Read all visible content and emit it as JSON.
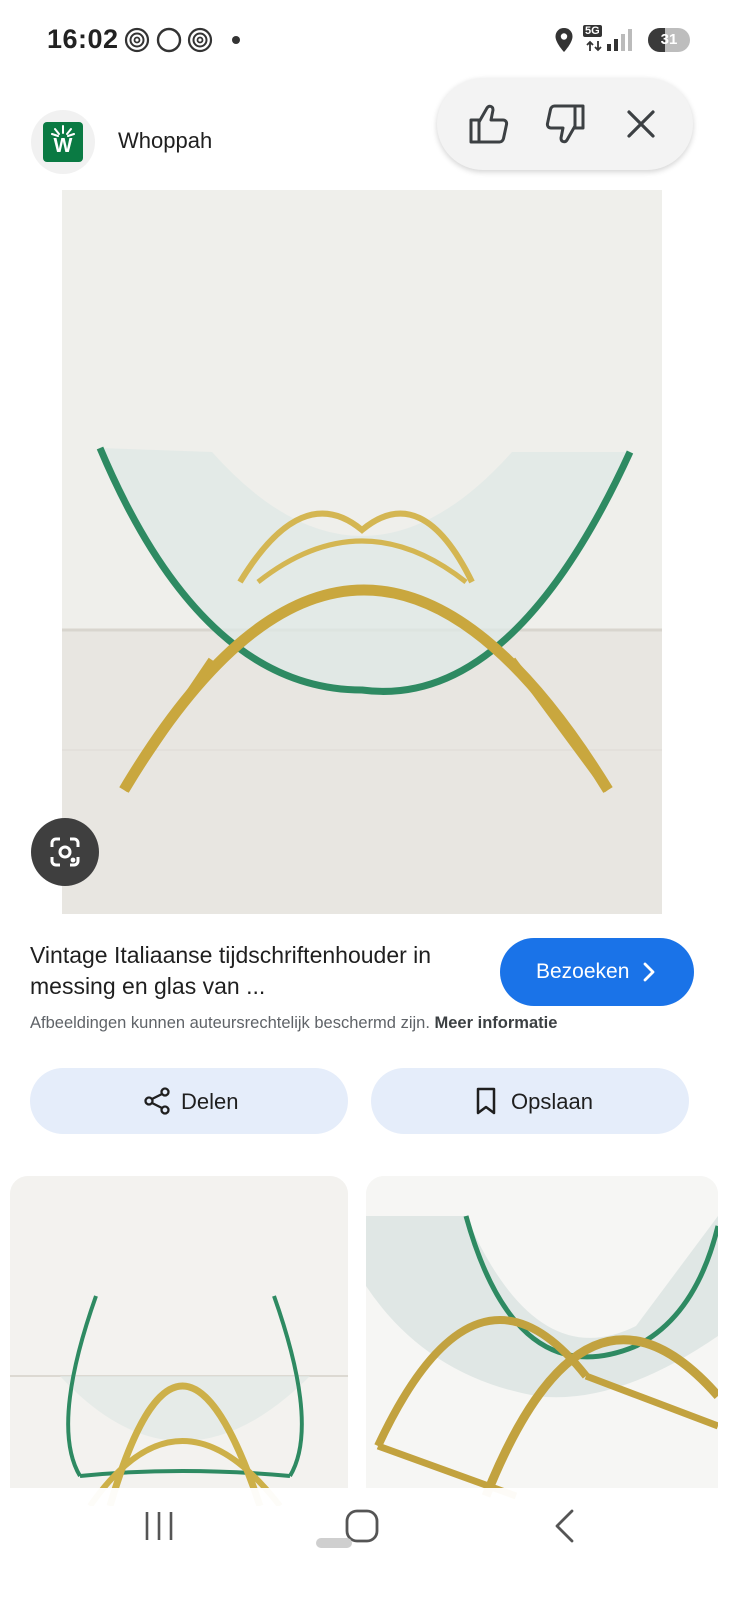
{
  "status_bar": {
    "time": "16:02",
    "signal_label": "5G",
    "battery_level": "31"
  },
  "header": {
    "source_name": "Whoppah",
    "logo_letter": "W",
    "brand_color": "#0a7a43"
  },
  "feedback": {
    "thumbs_up": "thumbs-up-icon",
    "thumbs_down": "thumbs-down-icon",
    "close": "close-icon"
  },
  "result": {
    "title": "Vintage Italiaanse tijdschriftenhouder in messing en glas van ...",
    "visit_label": "Bezoeken",
    "copyright_notice": "Afbeeldingen kunnen auteursrechtelijk beschermd zijn.",
    "more_info_label": "Meer informatie",
    "accent_color": "#1a73e8"
  },
  "actions": {
    "share_label": "Delen",
    "save_label": "Opslaan"
  },
  "related": {
    "count_visible": 2
  }
}
